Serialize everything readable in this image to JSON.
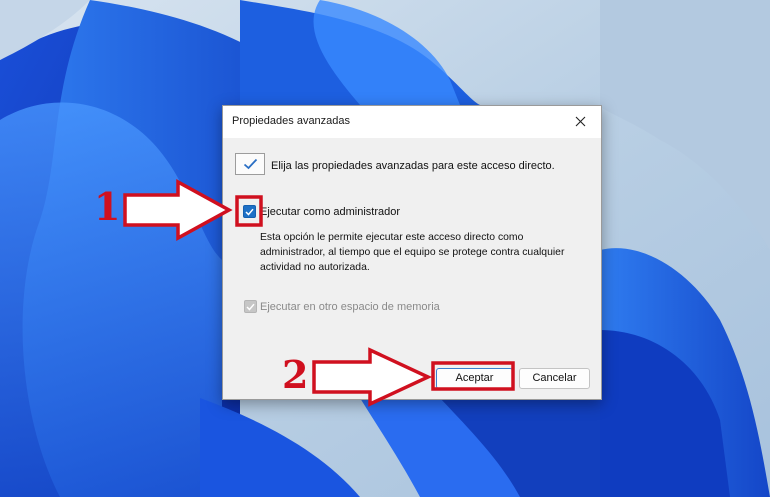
{
  "dialog": {
    "title": "Propiedades avanzadas",
    "intro": "Elija las propiedades avanzadas para este acceso directo.",
    "options": [
      {
        "label": "Ejecutar como administrador",
        "checked": true,
        "enabled": true
      },
      {
        "label": "Ejecutar en otro espacio de memoria",
        "checked": true,
        "enabled": false
      }
    ],
    "description_lines": [
      "Esta opción le permite ejecutar este acceso directo como",
      "administrador, al tiempo que el equipo se protege contra cualquier",
      "actividad no autorizada."
    ],
    "buttons": {
      "ok": "Aceptar",
      "cancel": "Cancelar"
    }
  },
  "annotations": {
    "step1": "1",
    "step2": "2",
    "color": "#d0101f"
  },
  "icons": [
    "close-icon",
    "checkmark-icon",
    "arrow-icon"
  ]
}
